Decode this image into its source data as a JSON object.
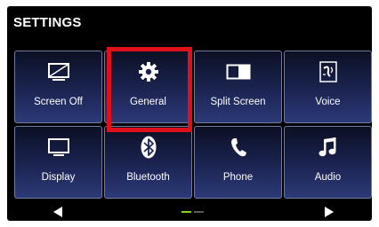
{
  "header": {
    "title": "SETTINGS"
  },
  "tiles": [
    {
      "label": "Screen Off",
      "icon": "screen-off-icon"
    },
    {
      "label": "General",
      "icon": "gear-icon",
      "selected": true
    },
    {
      "label": "Split Screen",
      "icon": "split-screen-icon"
    },
    {
      "label": "Voice",
      "icon": "voice-settings-icon"
    },
    {
      "label": "Display",
      "icon": "display-icon"
    },
    {
      "label": "Bluetooth",
      "icon": "bluetooth-icon"
    },
    {
      "label": "Phone",
      "icon": "phone-icon"
    },
    {
      "label": "Audio",
      "icon": "music-note-icon"
    }
  ],
  "pager": {
    "pages": 2,
    "current": 1,
    "active_color": "#7ed321",
    "inactive_color": "#5a5a5a"
  },
  "colors": {
    "selection": "#e0101b",
    "tile_border": "#6f7a9e",
    "background": "#000000"
  }
}
